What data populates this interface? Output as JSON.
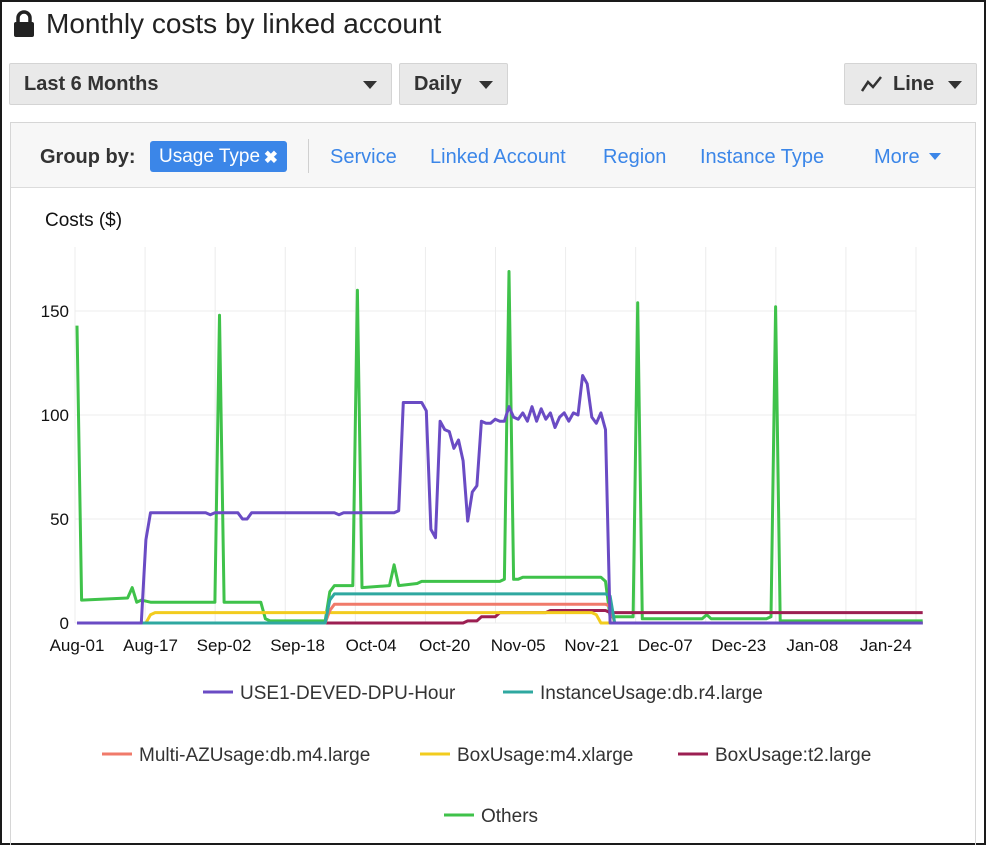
{
  "header": {
    "title": "Monthly costs by linked account",
    "lock_icon": "lock-icon"
  },
  "controls": {
    "time_range": "Last 6 Months",
    "granularity": "Daily",
    "chart_type": "Line",
    "chart_type_icon": "line-chart-icon"
  },
  "group_by": {
    "label": "Group by:",
    "active": "Usage Type",
    "remove_icon": "close-icon",
    "options": [
      "Service",
      "Linked Account",
      "Region",
      "Instance Type"
    ],
    "more": "More"
  },
  "colors": {
    "accent": "#3b86e8",
    "USE1": "#6a4bc4",
    "Instance": "#2fa8a0",
    "MultiAZ": "#f07a6a",
    "BoxM4": "#f2cc1e",
    "BoxT2": "#9c1f52",
    "Others": "#3fc24a"
  },
  "chart_data": {
    "type": "line",
    "ylabel": "Costs ($)",
    "ylim": [
      0,
      175
    ],
    "yticks": [
      0,
      50,
      100,
      150
    ],
    "x_start": "Aug-01",
    "x_tick_labels": [
      "Aug-01",
      "Aug-17",
      "Sep-02",
      "Sep-18",
      "Oct-04",
      "Oct-20",
      "Nov-05",
      "Nov-21",
      "Dec-07",
      "Dec-23",
      "Jan-08",
      "Jan-24"
    ],
    "x_tick_days": [
      0,
      16,
      32,
      48,
      64,
      80,
      96,
      112,
      128,
      144,
      160,
      176
    ],
    "grid": true,
    "legend_position": "bottom",
    "series": [
      {
        "name": "USE1-DEVED-DPU-Hour",
        "color": "#6a4bc4",
        "points": [
          [
            0,
            0
          ],
          [
            14,
            0
          ],
          [
            15,
            40
          ],
          [
            16,
            53
          ],
          [
            28,
            53
          ],
          [
            29,
            52
          ],
          [
            30,
            53
          ],
          [
            35,
            53
          ],
          [
            36,
            50
          ],
          [
            37,
            50
          ],
          [
            38,
            53
          ],
          [
            56,
            53
          ],
          [
            57,
            52
          ],
          [
            58,
            53
          ],
          [
            69,
            53
          ],
          [
            70,
            54
          ],
          [
            71,
            106
          ],
          [
            75,
            106
          ],
          [
            76,
            102
          ],
          [
            77,
            45
          ],
          [
            78,
            41
          ],
          [
            79,
            97
          ],
          [
            80,
            93
          ],
          [
            81,
            92
          ],
          [
            82,
            84
          ],
          [
            83,
            88
          ],
          [
            84,
            78
          ],
          [
            85,
            49
          ],
          [
            86,
            63
          ],
          [
            87,
            66
          ],
          [
            88,
            97
          ],
          [
            89,
            96
          ],
          [
            90,
            96
          ],
          [
            91,
            98
          ],
          [
            92,
            97
          ],
          [
            93,
            97
          ],
          [
            94,
            104
          ],
          [
            95,
            99
          ],
          [
            96,
            98
          ],
          [
            97,
            101
          ],
          [
            98,
            97
          ],
          [
            99,
            104
          ],
          [
            100,
            97
          ],
          [
            101,
            103
          ],
          [
            102,
            98
          ],
          [
            103,
            101
          ],
          [
            104,
            94
          ],
          [
            105,
            99
          ],
          [
            106,
            101
          ],
          [
            107,
            97
          ],
          [
            108,
            101
          ],
          [
            109,
            100
          ],
          [
            110,
            119
          ],
          [
            111,
            115
          ],
          [
            112,
            99
          ],
          [
            113,
            96
          ],
          [
            114,
            101
          ],
          [
            115,
            93
          ],
          [
            116,
            0
          ],
          [
            184,
            0
          ]
        ]
      },
      {
        "name": "InstanceUsage:db.r4.large",
        "color": "#2fa8a0",
        "points": [
          [
            0,
            0
          ],
          [
            54,
            0
          ],
          [
            55,
            11
          ],
          [
            56,
            14
          ],
          [
            115,
            14
          ],
          [
            116,
            13
          ],
          [
            117,
            0
          ],
          [
            184,
            0
          ]
        ]
      },
      {
        "name": "Multi-AZUsage:db.m4.large",
        "color": "#f07a6a",
        "points": [
          [
            0,
            0
          ],
          [
            54,
            0
          ],
          [
            55,
            6
          ],
          [
            56,
            9
          ],
          [
            115,
            9
          ],
          [
            116,
            8
          ],
          [
            117,
            0
          ],
          [
            184,
            0
          ]
        ]
      },
      {
        "name": "BoxUsage:m4.xlarge",
        "color": "#f2cc1e",
        "points": [
          [
            0,
            0
          ],
          [
            15,
            0
          ],
          [
            16,
            4
          ],
          [
            17,
            5
          ],
          [
            112,
            5
          ],
          [
            113,
            4
          ],
          [
            114,
            0
          ],
          [
            184,
            0
          ]
        ]
      },
      {
        "name": "BoxUsage:t2.large",
        "color": "#9c1f52",
        "points": [
          [
            0,
            0
          ],
          [
            84,
            0
          ],
          [
            85,
            1
          ],
          [
            87,
            1
          ],
          [
            88,
            3
          ],
          [
            91,
            3
          ],
          [
            92,
            5
          ],
          [
            102,
            5
          ],
          [
            103,
            6
          ],
          [
            115,
            6
          ],
          [
            116,
            5
          ],
          [
            184,
            5
          ]
        ]
      },
      {
        "name": "Others",
        "color": "#3fc24a",
        "points": [
          [
            0,
            143
          ],
          [
            1,
            11
          ],
          [
            11,
            12
          ],
          [
            12,
            17
          ],
          [
            13,
            10
          ],
          [
            14,
            11
          ],
          [
            16,
            10
          ],
          [
            30,
            10
          ],
          [
            31,
            148
          ],
          [
            32,
            10
          ],
          [
            40,
            10
          ],
          [
            41,
            2
          ],
          [
            42,
            1
          ],
          [
            54,
            1
          ],
          [
            55,
            15
          ],
          [
            56,
            18
          ],
          [
            60,
            18
          ],
          [
            61,
            160
          ],
          [
            62,
            17
          ],
          [
            68,
            18
          ],
          [
            69,
            28
          ],
          [
            70,
            18
          ],
          [
            74,
            19
          ],
          [
            75,
            20
          ],
          [
            92,
            20
          ],
          [
            93,
            21
          ],
          [
            94,
            169
          ],
          [
            95,
            21
          ],
          [
            96,
            21
          ],
          [
            97,
            22
          ],
          [
            114,
            22
          ],
          [
            115,
            20
          ],
          [
            116,
            3
          ],
          [
            121,
            3
          ],
          [
            122,
            154
          ],
          [
            123,
            2
          ],
          [
            136,
            2
          ],
          [
            137,
            4
          ],
          [
            138,
            2
          ],
          [
            150,
            2
          ],
          [
            151,
            3
          ],
          [
            152,
            152
          ],
          [
            153,
            1
          ],
          [
            184,
            1
          ]
        ]
      }
    ]
  }
}
